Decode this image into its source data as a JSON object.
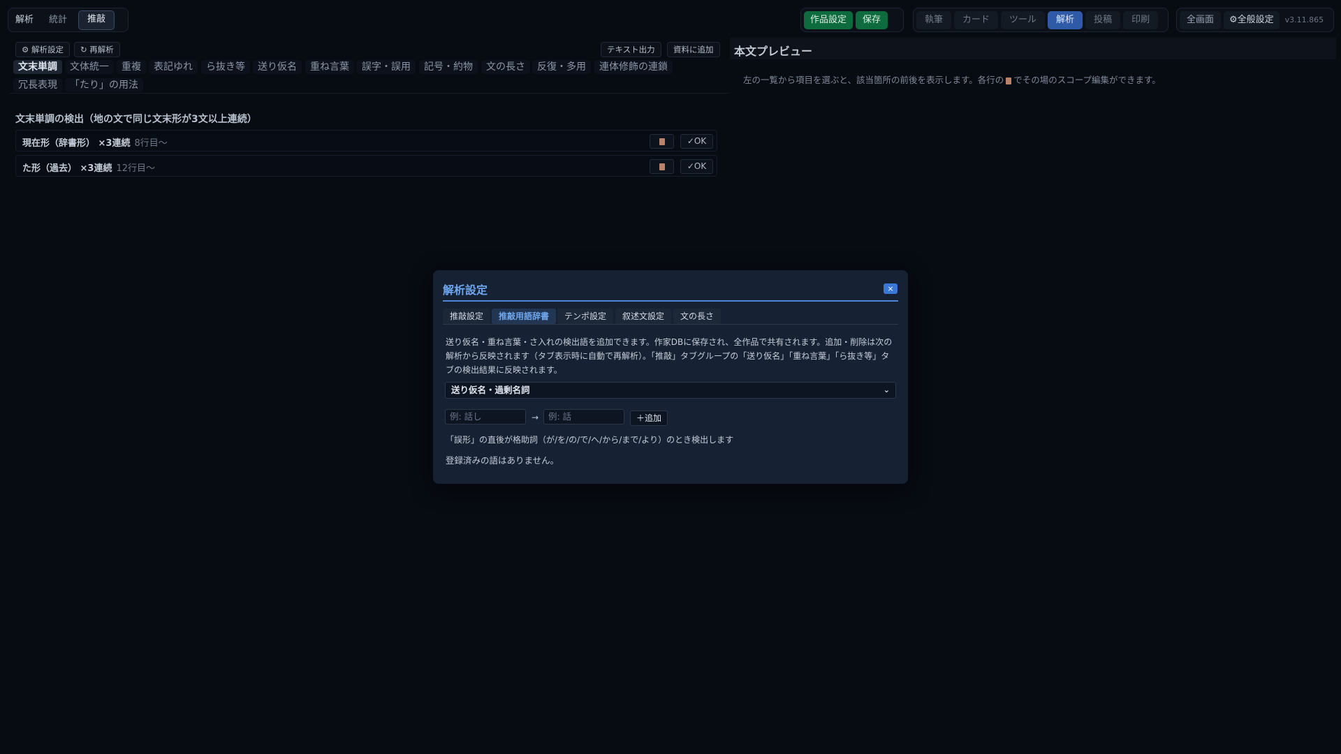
{
  "mode_tabs": [
    "解析",
    "統計",
    "推敲"
  ],
  "actions": {
    "work_settings": "作品設定",
    "save": "保存"
  },
  "main_tabs": [
    "執筆",
    "カード",
    "ツール",
    "解析",
    "投稿",
    "印刷"
  ],
  "view": {
    "fullscreen": "全画面",
    "global_settings": "⚙全般設定",
    "version": "v3.11.865"
  },
  "left": {
    "settings_btn": "⚙ 解析設定",
    "reanalyze_btn": "↻ 再解析",
    "export_btn": "テキスト出力",
    "add_to_material_btn": "資料に追加",
    "categories_row1": [
      "文末単調",
      "文体統一",
      "重複",
      "表記ゆれ",
      "ら抜き等",
      "送り仮名",
      "重ね言葉",
      "誤字・誤用",
      "記号・約物",
      "文の長さ",
      "反復・多用",
      "連体修飾の連鎖"
    ],
    "categories_row2": [
      "冗長表現",
      "「たり」の用法"
    ],
    "section_title": "文末単調の検出（地の文で同じ文末形が3文以上連続）",
    "results": [
      {
        "label": "現在形（辞書形） ×3連続",
        "line": "8行目〜",
        "ok": "✓OK"
      },
      {
        "label": "た形（過去） ×3連続",
        "line": "12行目〜",
        "ok": "✓OK"
      }
    ]
  },
  "preview": {
    "title": "本文プレビュー",
    "hint_before": "左の一覧から項目を選ぶと、該当箇所の前後を表示します。各行の",
    "hint_after": "でその場のスコープ編集ができます。"
  },
  "modal": {
    "title": "解析設定",
    "close": "×",
    "tabs": [
      "推敲設定",
      "推敲用語辞書",
      "テンポ設定",
      "叙述文設定",
      "文の長さ"
    ],
    "description": "送り仮名・重ね言葉・さ入れの検出語を追加できます。作家DBに保存され、全作品で共有されます。追加・削除は次の解析から反映されます（タブ表示時に自動で再解析）。「推敲」タブグループの「送り仮名」「重ね言葉」「ら抜き等」タブの検出結果に反映されます。",
    "select_value": "送り仮名・過剰名詞",
    "input_from_placeholder": "例: 話し",
    "arrow": "→",
    "input_to_placeholder": "例: 話",
    "add_btn": "＋追加",
    "hint": "「誤形」の直後が格助詞（が/を/の/で/へ/から/まで/より）のとき検出します",
    "empty": "登録済みの語はありません。"
  }
}
